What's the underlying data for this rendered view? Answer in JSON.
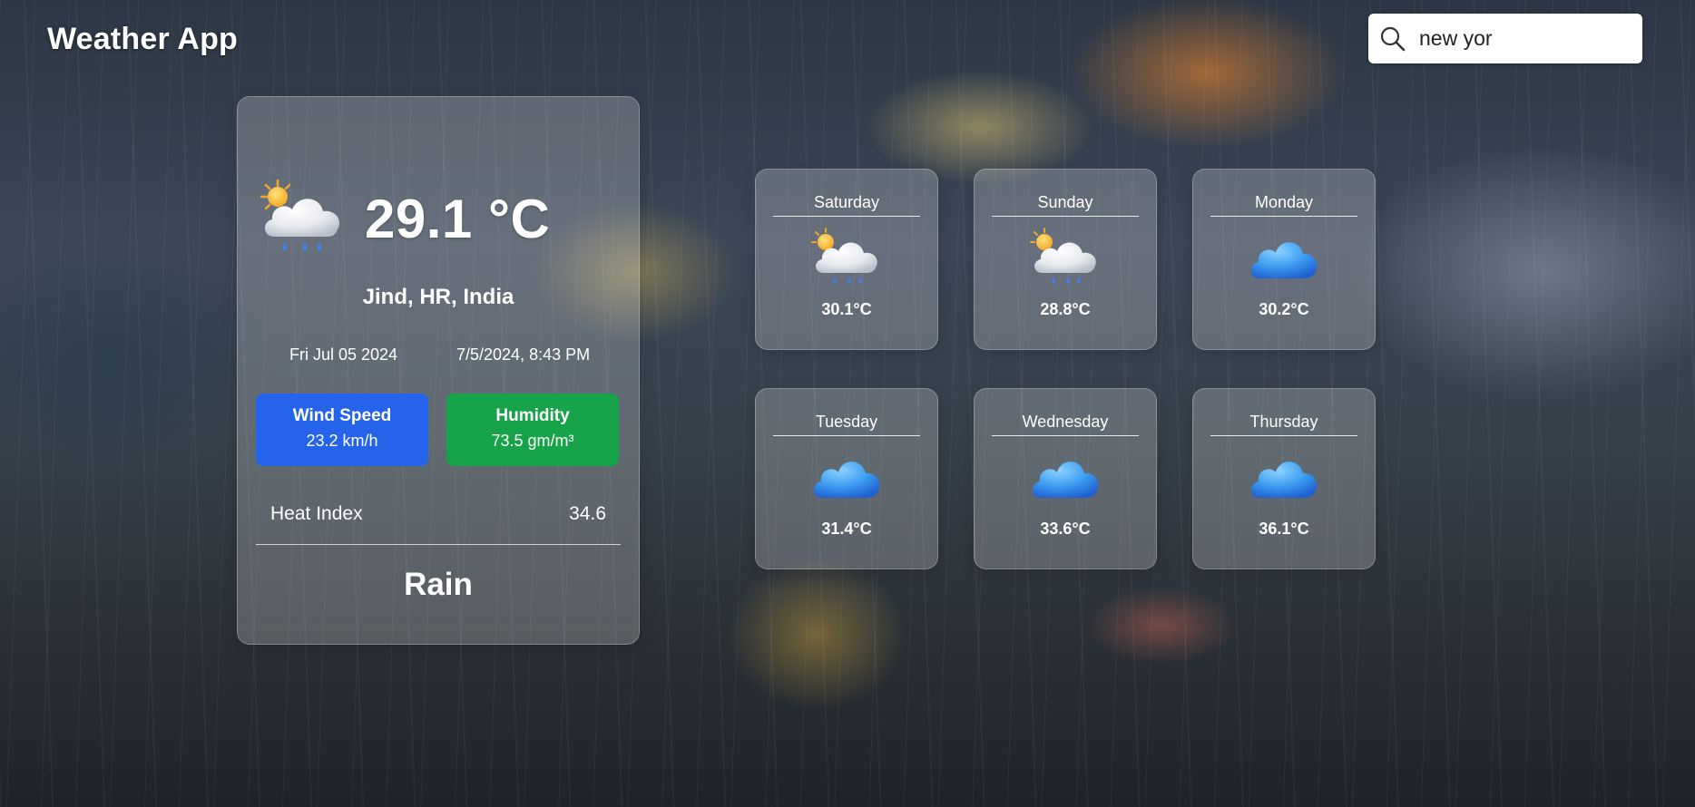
{
  "app": {
    "title": "Weather App"
  },
  "search": {
    "value": "new yor"
  },
  "current": {
    "icon": "sun-behind-rain-cloud-icon",
    "temperature": "29.1 °C",
    "location": "Jind, HR, India",
    "date": "Fri Jul 05 2024",
    "datetime": "7/5/2024, 8:43 PM",
    "wind": {
      "label": "Wind Speed",
      "value": "23.2 km/h"
    },
    "humidity": {
      "label": "Humidity",
      "value": "73.5 gm/m³"
    },
    "heat_index": {
      "label": "Heat Index",
      "value": "34.6"
    },
    "condition": "Rain"
  },
  "forecast": [
    {
      "day": "Saturday",
      "temp": "30.1°C",
      "icon": "sun-behind-rain-cloud-icon"
    },
    {
      "day": "Sunday",
      "temp": "28.8°C",
      "icon": "sun-behind-rain-cloud-icon"
    },
    {
      "day": "Monday",
      "temp": "30.2°C",
      "icon": "cloud-icon"
    },
    {
      "day": "Tuesday",
      "temp": "31.4°C",
      "icon": "cloud-icon"
    },
    {
      "day": "Wednesday",
      "temp": "33.6°C",
      "icon": "cloud-icon"
    },
    {
      "day": "Thursday",
      "temp": "36.1°C",
      "icon": "cloud-icon"
    }
  ],
  "colors": {
    "wind_box": "#2563eb",
    "humidity_box": "#16a34a",
    "cloud_blue": "#3b9cf0"
  }
}
